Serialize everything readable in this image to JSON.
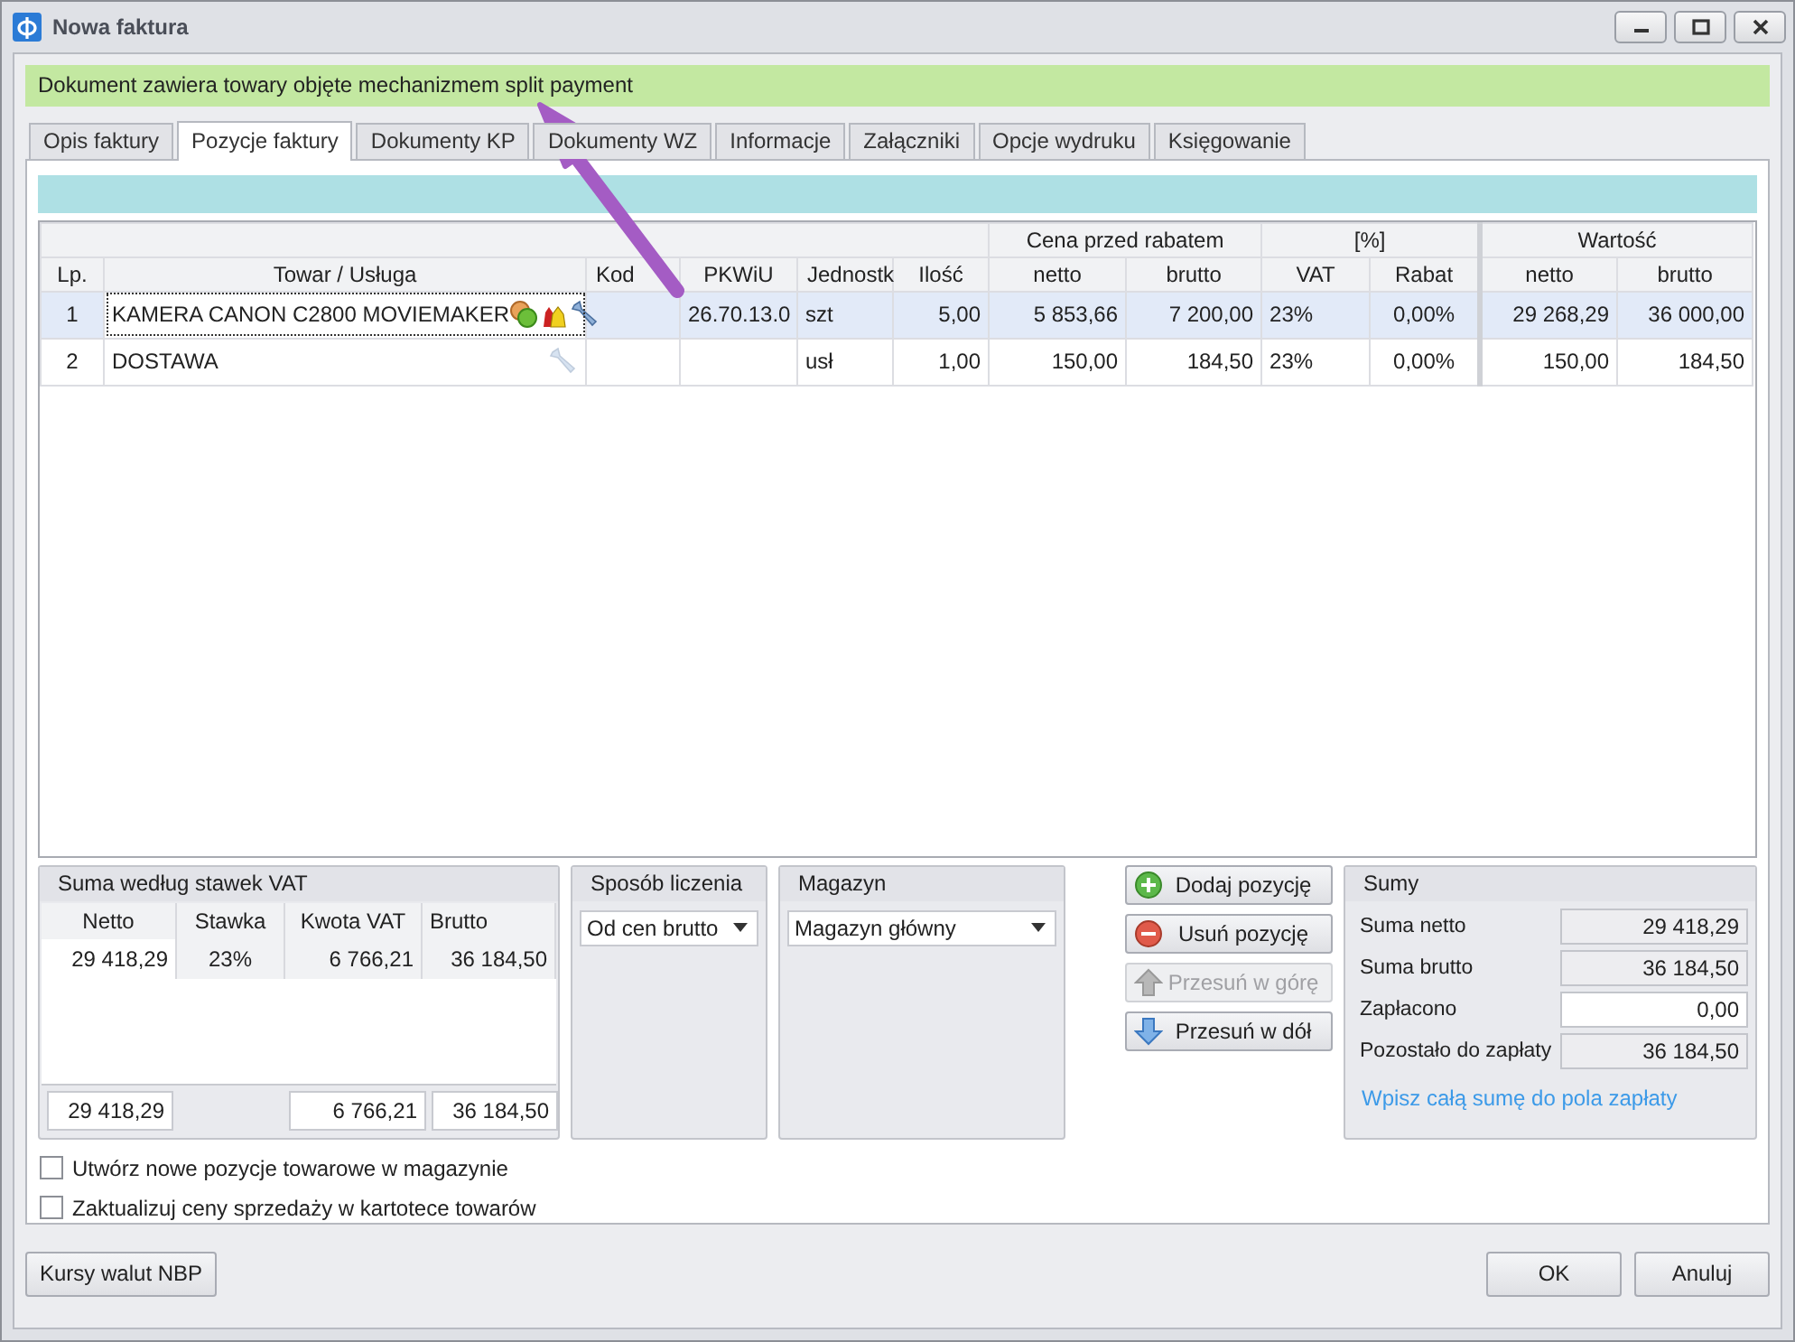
{
  "window": {
    "title": "Nowa faktura"
  },
  "banner": "Dokument zawiera towary objęte mechanizmem split payment",
  "tabs": [
    {
      "label": "Opis faktury",
      "selected": false
    },
    {
      "label": "Pozycje faktury",
      "selected": true
    },
    {
      "label": "Dokumenty KP",
      "selected": false
    },
    {
      "label": "Dokumenty WZ",
      "selected": false
    },
    {
      "label": "Informacje",
      "selected": false
    },
    {
      "label": "Załączniki",
      "selected": false
    },
    {
      "label": "Opcje wydruku",
      "selected": false
    },
    {
      "label": "Księgowanie",
      "selected": false
    }
  ],
  "table": {
    "group_headers": [
      "Cena przed rabatem",
      "[%]",
      "Wartość"
    ],
    "columns": [
      "Lp.",
      "Towar / Usługa",
      "Kod",
      "PKWiU",
      "Jednostk",
      "Ilość",
      "netto",
      "brutto",
      "VAT",
      "Rabat",
      "netto",
      "brutto"
    ],
    "rows": [
      {
        "selected": true,
        "focused": true,
        "lp": "1",
        "name": "KAMERA CANON C2800 MOVIEMAKER",
        "icons": [
          {
            "kind": "coins",
            "disabled": false
          },
          {
            "kind": "bags",
            "disabled": false
          },
          {
            "kind": "wrench",
            "disabled": false
          }
        ],
        "kod": "",
        "pkwiu": "26.70.13.0",
        "unit": "szt",
        "qty": "5,00",
        "price_net": "5 853,66",
        "price_gross": "7 200,00",
        "vat": "23%",
        "discount": "0,00%",
        "value_net": "29 268,29",
        "value_gross": "36 000,00"
      },
      {
        "selected": false,
        "focused": false,
        "lp": "2",
        "name": "DOSTAWA",
        "icons": [
          {
            "kind": "wrench",
            "disabled": true
          }
        ],
        "kod": "",
        "pkwiu": "",
        "unit": "usł",
        "qty": "1,00",
        "price_net": "150,00",
        "price_gross": "184,50",
        "vat": "23%",
        "discount": "0,00%",
        "value_net": "150,00",
        "value_gross": "184,50"
      }
    ]
  },
  "vat_summary": {
    "title": "Suma według stawek VAT",
    "columns": [
      "Netto",
      "Stawka",
      "Kwota VAT",
      "Brutto"
    ],
    "rows": [
      {
        "netto": "29 418,29",
        "rate": "23%",
        "vat": "6 766,21",
        "brutto": "36 184,50"
      }
    ],
    "totals": {
      "netto": "29 418,29",
      "vat": "6 766,21",
      "brutto": "36 184,50"
    }
  },
  "calc_method": {
    "title": "Sposób liczenia",
    "value": "Od cen brutto"
  },
  "warehouse": {
    "title": "Magazyn",
    "value": "Magazyn główny"
  },
  "actions": [
    {
      "label": "Dodaj pozycję",
      "kind": "add",
      "disabled": false
    },
    {
      "label": "Usuń pozycję",
      "kind": "remove",
      "disabled": false
    },
    {
      "label": "Przesuń w górę",
      "kind": "up",
      "disabled": true
    },
    {
      "label": "Przesuń w dół",
      "kind": "down",
      "disabled": false
    }
  ],
  "sums": {
    "title": "Sumy",
    "fields": [
      {
        "label": "Suma netto",
        "value": "29 418,29",
        "editable": false
      },
      {
        "label": "Suma brutto",
        "value": "36 184,50",
        "editable": false
      },
      {
        "label": "Zapłacono",
        "value": "0,00",
        "editable": true
      },
      {
        "label": "Pozostało do zapłaty",
        "value": "36 184,50",
        "editable": false
      }
    ],
    "link": "Wpisz całą sumę do pola zapłaty"
  },
  "checkboxes": [
    {
      "label": "Utwórz nowe pozycje towarowe w magazynie",
      "checked": false
    },
    {
      "label": "Zaktualizuj ceny sprzedaży w kartotece towarów",
      "checked": false
    }
  ],
  "footer_left": "Kursy walut NBP",
  "footer_buttons": [
    "OK",
    "Anuluj"
  ]
}
